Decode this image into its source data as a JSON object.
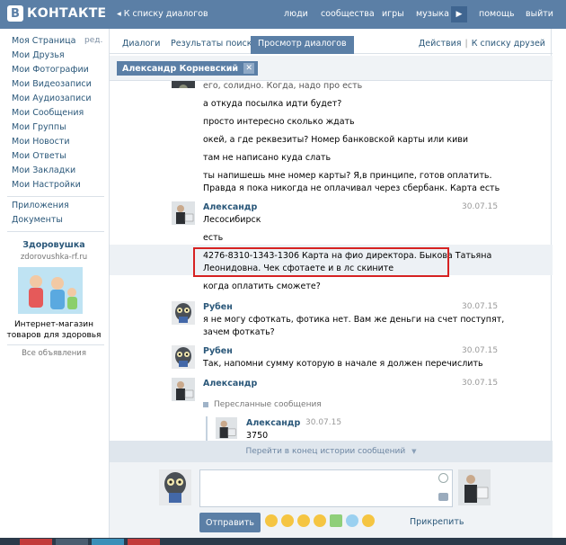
{
  "header": {
    "logo_letter": "B",
    "logo_text": "КОНТАКТЕ",
    "back_link": "◂ К списку диалогов",
    "nav": [
      "люди",
      "сообщества",
      "игры",
      "музыка",
      "помощь",
      "выйти"
    ],
    "play_glyph": "▶"
  },
  "sidebar": {
    "items": [
      "Моя Страница",
      "Мои Друзья",
      "Мои Фотографии",
      "Мои Видеозаписи",
      "Мои Аудиозаписи",
      "Мои Сообщения",
      "Мои Группы",
      "Мои Новости",
      "Мои Ответы",
      "Мои Закладки",
      "Мои Настройки"
    ],
    "edit_label": "ред.",
    "extra_items": [
      "Приложения",
      "Документы"
    ],
    "ad": {
      "title": "Здоровушка",
      "site": "zdorovushka-rf.ru",
      "text_line1": "Интернет-магазин",
      "text_line2": "товаров для здоровья",
      "all_ads": "Все объявления"
    }
  },
  "tabs": {
    "items": [
      "Диалоги",
      "Результаты поиска"
    ],
    "active": "Просмотр диалогов",
    "actions": "Действия",
    "to_friends": "К списку друзей",
    "separator": "|"
  },
  "peer": {
    "name": "Александр Корневский",
    "close_glyph": "✕"
  },
  "messages": {
    "cut_top": "его, солидно. Когда, надо про есть",
    "m1": "а откуда посылка идти будет?",
    "m2": "просто интересно сколько ждать",
    "m3": "окей, а где реквезиты? Номер банковской карты или киви",
    "m4": "там не написано куда слать",
    "m5a": "ты напишешь мне номер карты? Я,в принципе, готов оплатить.",
    "m5b": "Правда я пока никогда не оплачивал через сбербанк. Карта есть",
    "a1_name": "Александр",
    "a1_date": "30.07.15",
    "a1_m1": "Лесосибирск",
    "a1_m2": "есть",
    "card_line1": "4276-8310-1343-1306 Карта на фио директора. Быкова Татьяна",
    "card_line2": "Леонидовна. Чек сфотаете и в лс скините",
    "a1_m3": "когда оплатить сможете?",
    "r1_name": "Рубен",
    "r1_date": "30.07.15",
    "r1_m1": "я не могу сфоткать, фотика нет. Вам же деньги на счет поступят,",
    "r1_m2": "зачем фоткать?",
    "r2_name": "Рубен",
    "r2_date": "30.07.15",
    "r2_m1": "Так, напомни сумму которую в начале я должен перечислить",
    "a2_name": "Александр",
    "a2_date": "30.07.15",
    "fwd_label": "Пересланные сообщения",
    "fwd_name": "Александр",
    "fwd_date": "30.07.15",
    "fwd_text": "3750"
  },
  "bottom": {
    "history_link": "Перейти в конец истории сообщений",
    "send": "Отправить",
    "attach": "Прикрепить"
  },
  "colors": {
    "brand": "#5b7fa6",
    "link": "#2b587a",
    "highlight_border": "#d62222"
  }
}
